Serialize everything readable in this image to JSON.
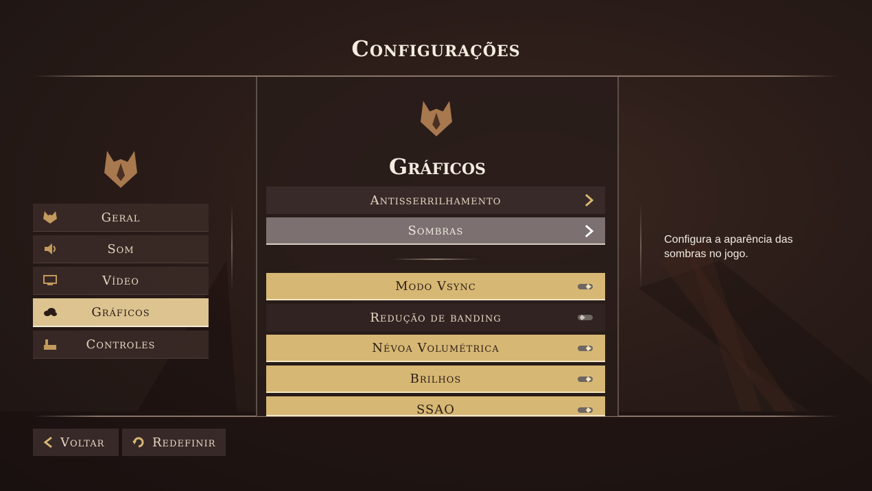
{
  "page": {
    "title": "Configurações"
  },
  "sidebar": {
    "items": [
      {
        "label": "Geral",
        "icon": "fox-icon",
        "active": false
      },
      {
        "label": "Som",
        "icon": "speaker-icon",
        "active": false
      },
      {
        "label": "Vídeo",
        "icon": "monitor-icon",
        "active": false
      },
      {
        "label": "Gráficos",
        "icon": "cloud-icon",
        "active": true
      },
      {
        "label": "Controles",
        "icon": "hand-icon",
        "active": false
      }
    ]
  },
  "main": {
    "title": "Gráficos",
    "submenus": [
      {
        "label": "Antisserrilhamento"
      },
      {
        "label": "Sombras"
      }
    ],
    "toggles": [
      {
        "label": "Modo Vsync",
        "enabled": true
      },
      {
        "label": "Redução de banding",
        "enabled": false
      },
      {
        "label": "Névoa Volumétrica",
        "enabled": true
      },
      {
        "label": "Brilhos",
        "enabled": true
      },
      {
        "label": "SSAO",
        "enabled": true
      }
    ]
  },
  "description": {
    "text": "Configura a aparência das sombras no jogo."
  },
  "footer": {
    "back_label": "Voltar",
    "reset_label": "Redefinir"
  },
  "colors": {
    "accent": "#d6b774",
    "highlight": "#7c7070",
    "emblem": "#a8784e"
  }
}
